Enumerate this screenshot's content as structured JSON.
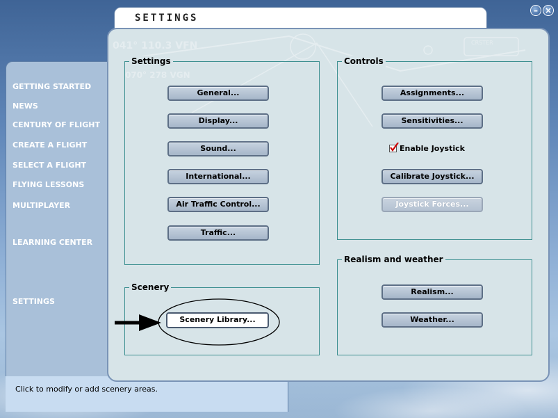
{
  "window_buttons": {
    "minimize": "–",
    "close": "×"
  },
  "tab": {
    "title": "SETTINGS"
  },
  "nav": {
    "items": [
      {
        "label": "GETTING STARTED"
      },
      {
        "label": "NEWS"
      },
      {
        "label": "CENTURY OF FLIGHT"
      },
      {
        "label": "CREATE A FLIGHT"
      },
      {
        "label": "SELECT A FLIGHT"
      },
      {
        "label": "FLYING LESSONS"
      },
      {
        "label": "MULTIPLAYER"
      },
      {
        "label": "LEARNING CENTER"
      },
      {
        "label": "SETTINGS"
      }
    ]
  },
  "status": {
    "text": "Click to modify or add scenery areas."
  },
  "groups": {
    "settings": {
      "title": "Settings",
      "buttons": [
        {
          "label": "General..."
        },
        {
          "label": "Display..."
        },
        {
          "label": "Sound..."
        },
        {
          "label": "International..."
        },
        {
          "label": "Air Traffic Control..."
        },
        {
          "label": "Traffic..."
        }
      ]
    },
    "controls": {
      "title": "Controls",
      "assignments": "Assignments...",
      "sensitivities": "Sensitivities...",
      "enable_joystick": "Enable Joystick",
      "enable_joystick_checked": true,
      "calibrate": "Calibrate Joystick...",
      "forces": "Joystick Forces..."
    },
    "scenery": {
      "title": "Scenery",
      "library": "Scenery Library..."
    },
    "realism": {
      "title": "Realism and weather",
      "realism": "Realism...",
      "weather": "Weather..."
    }
  },
  "watermark": {
    "text1": "041° 110.3 VFN",
    "text2": "070° 278 VGN",
    "text3": "CRSTER"
  },
  "colors": {
    "accent": "#3c8f90",
    "check": "#cc0000"
  }
}
